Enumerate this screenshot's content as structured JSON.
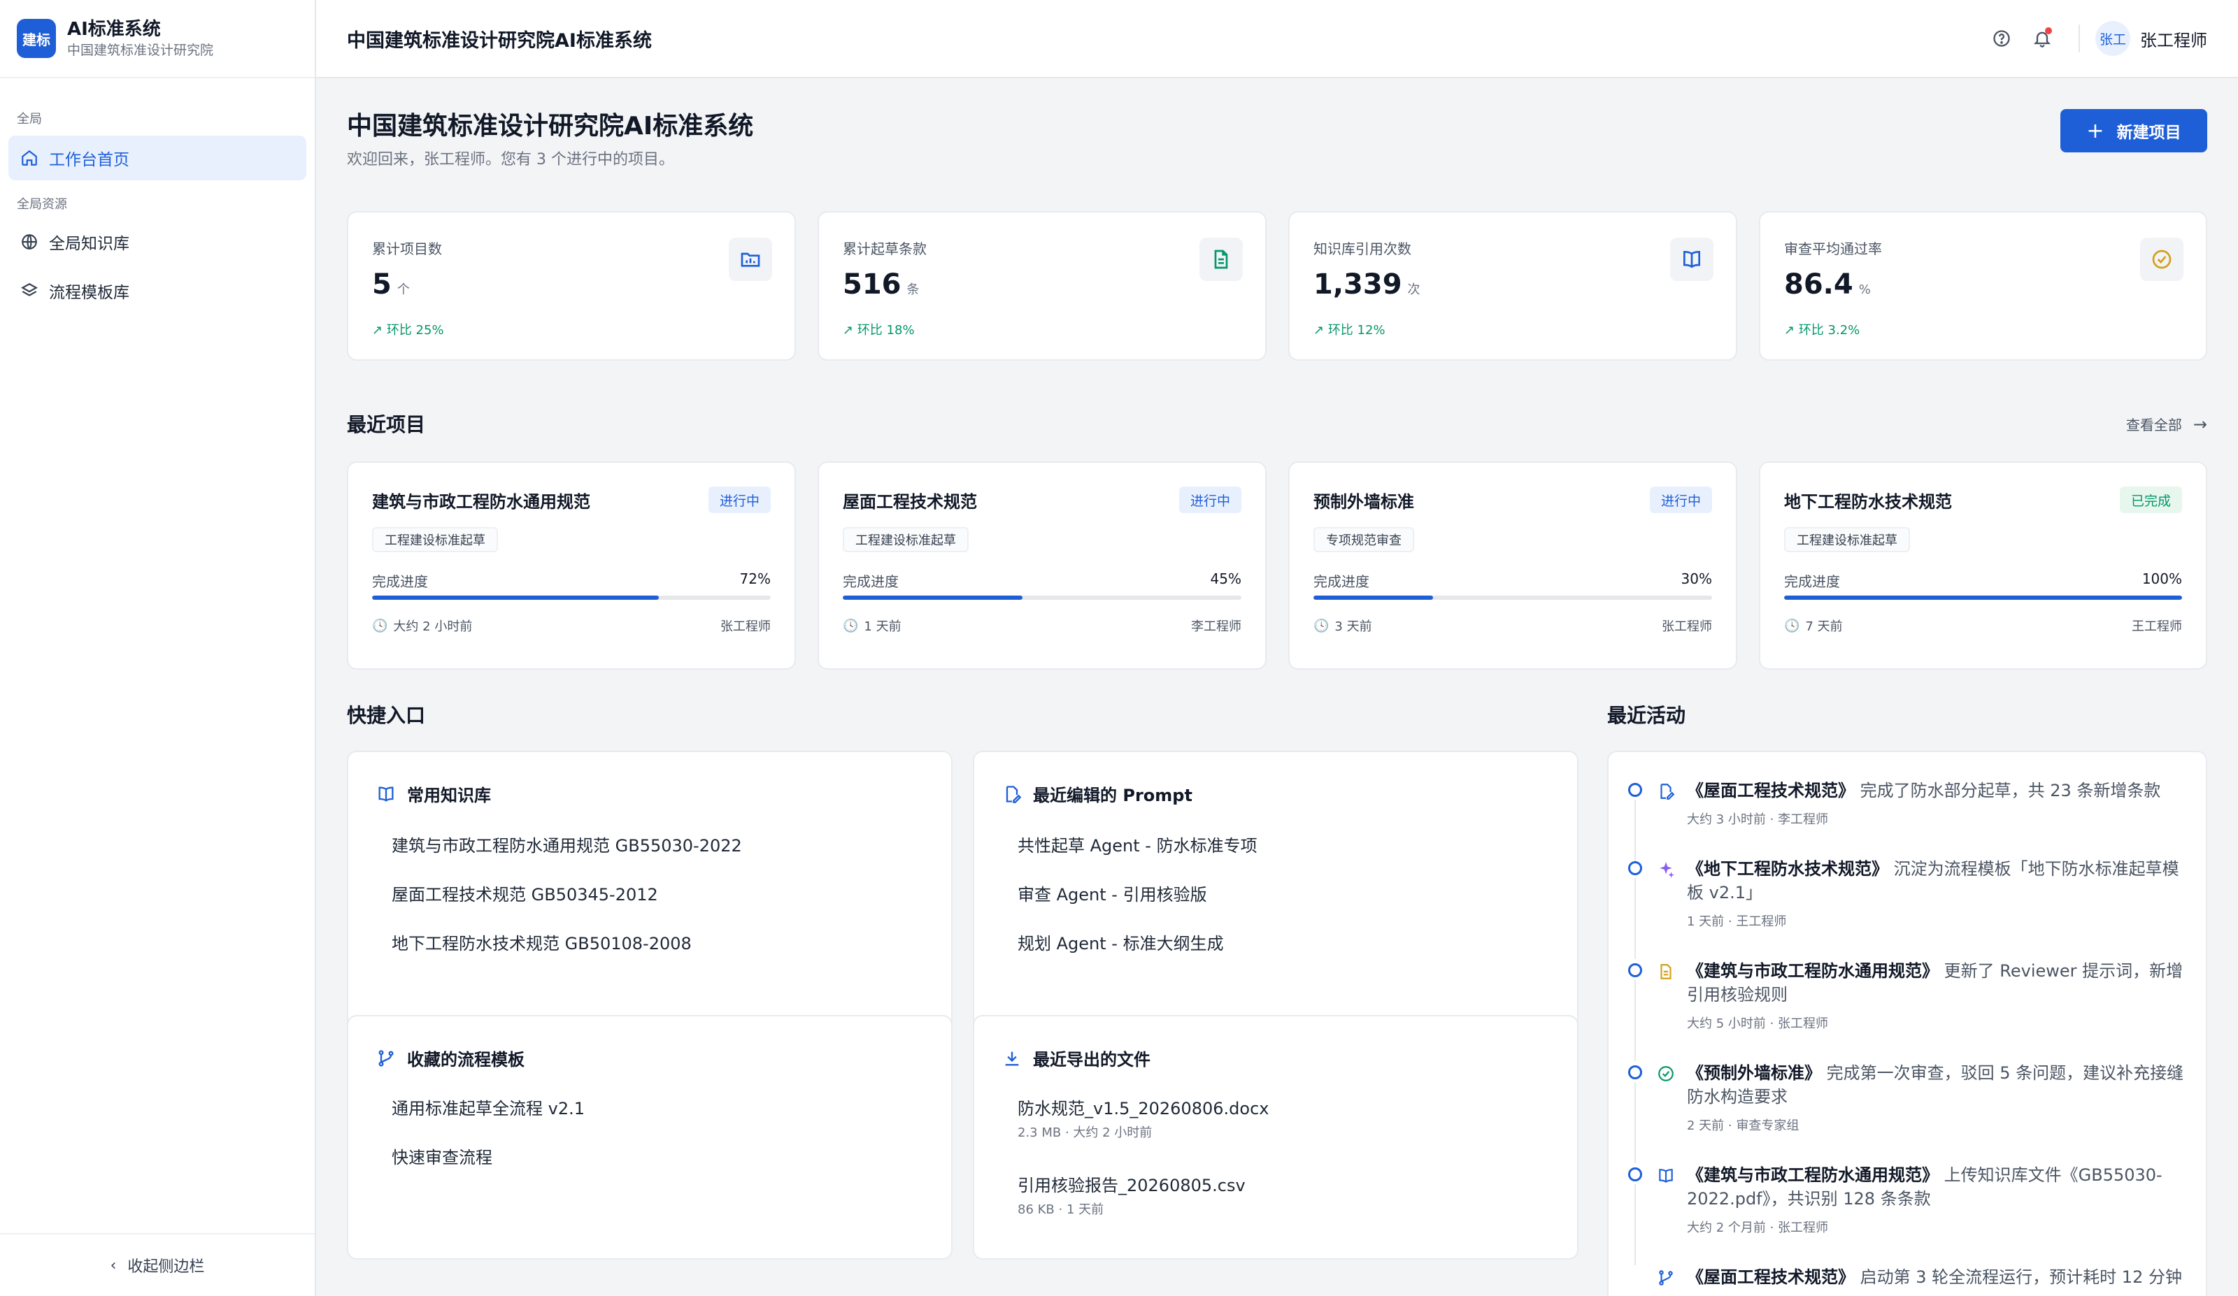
{
  "brand": {
    "logo": "建标",
    "title": "AI标准系统",
    "subtitle": "中国建筑标准设计研究院"
  },
  "sidebar": {
    "section_global": "全局",
    "home": "工作台首页",
    "section_resources": "全局资源",
    "knowledge": "全局知识库",
    "templates": "流程模板库",
    "collapse": "收起侧边栏"
  },
  "topbar": {
    "title": "中国建筑标准设计研究院AI标准系统",
    "avatar": "张工",
    "user": "张工程师"
  },
  "header": {
    "title": "中国建筑标准设计研究院AI标准系统",
    "welcome": "欢迎回来，张工程师。您有 3 个进行中的项目。",
    "new_button": "新建项目"
  },
  "stats": [
    {
      "label": "累计项目数",
      "value": "5",
      "unit": "个",
      "trend": "环比 25%",
      "icon": "folder-chart-icon"
    },
    {
      "label": "累计起草条款",
      "value": "516",
      "unit": "条",
      "trend": "环比 18%",
      "icon": "document-icon"
    },
    {
      "label": "知识库引用次数",
      "value": "1,339",
      "unit": "次",
      "trend": "环比 12%",
      "icon": "book-icon"
    },
    {
      "label": "审查平均通过率",
      "value": "86.4",
      "unit": "%",
      "trend": "环比 3.2%",
      "icon": "check-circle-icon"
    }
  ],
  "recent": {
    "title": "最近项目",
    "view_all": "查看全部",
    "progress_label": "完成进度",
    "projects": [
      {
        "name": "建筑与市政工程防水通用规范",
        "status": "进行中",
        "tag": "工程建设标准起草",
        "progress": "72%",
        "time": "大约 2 小时前",
        "owner": "张工程师"
      },
      {
        "name": "屋面工程技术规范",
        "status": "进行中",
        "tag": "工程建设标准起草",
        "progress": "45%",
        "time": "1 天前",
        "owner": "李工程师"
      },
      {
        "name": "预制外墙标准",
        "status": "进行中",
        "tag": "专项规范审查",
        "progress": "30%",
        "time": "3 天前",
        "owner": "张工程师"
      },
      {
        "name": "地下工程防水技术规范",
        "status": "已完成",
        "tag": "工程建设标准起草",
        "progress": "100%",
        "time": "7 天前",
        "owner": "王工程师"
      }
    ]
  },
  "quick": {
    "title": "快捷入口",
    "kb": {
      "title": "常用知识库",
      "items": [
        "建筑与市政工程防水通用规范 GB55030-2022",
        "屋面工程技术规范 GB50345-2012",
        "地下工程防水技术规范 GB50108-2008"
      ]
    },
    "prompt": {
      "title": "最近编辑的 Prompt",
      "items": [
        "共性起草 Agent - 防水标准专项",
        "审查 Agent - 引用核验版",
        "规划 Agent - 标准大纲生成"
      ]
    },
    "flows": {
      "title": "收藏的流程模板",
      "items": [
        "通用标准起草全流程 v2.1",
        "快速审查流程"
      ]
    },
    "exports": {
      "title": "最近导出的文件",
      "files": [
        {
          "name": "防水规范_v1.5_20260806.docx",
          "meta": "2.3 MB  ·  大约 2 小时前"
        },
        {
          "name": "引用核验报告_20260805.csv",
          "meta": "86 KB  ·  1 天前"
        }
      ]
    }
  },
  "activity": {
    "title": "最近活动",
    "items": [
      {
        "subject": "《屋面工程技术规范》",
        "text": "完成了防水部分起草，共 23 条新增条款",
        "meta": "大约 3 小时前  ·  李工程师",
        "icon": "draft-icon"
      },
      {
        "subject": "《地下工程防水技术规范》",
        "text": "沉淀为流程模板「地下防水标准起草模板 v2.1」",
        "meta": "1 天前  ·  王工程师",
        "icon": "sparkle-icon"
      },
      {
        "subject": "《建筑与市政工程防水通用规范》",
        "text": "更新了 Reviewer 提示词，新增引用核验规则",
        "meta": "大约 5 小时前  ·  张工程师",
        "icon": "note-icon"
      },
      {
        "subject": "《预制外墙标准》",
        "text": "完成第一次审查，驳回 5 条问题，建议补充接缝防水构造要求",
        "meta": "2 天前  ·  审查专家组",
        "icon": "check-circle-icon"
      },
      {
        "subject": "《建筑与市政工程防水通用规范》",
        "text": "上传知识库文件《GB55030-2022.pdf》，共识别 128 条条款",
        "meta": "大约 2 个月前  ·  张工程师",
        "icon": "book-icon"
      },
      {
        "subject": "《屋面工程技术规范》",
        "text": "启动第 3 轮全流程运行，预计耗时 12 分钟",
        "meta": "",
        "icon": "branch-icon"
      }
    ]
  }
}
